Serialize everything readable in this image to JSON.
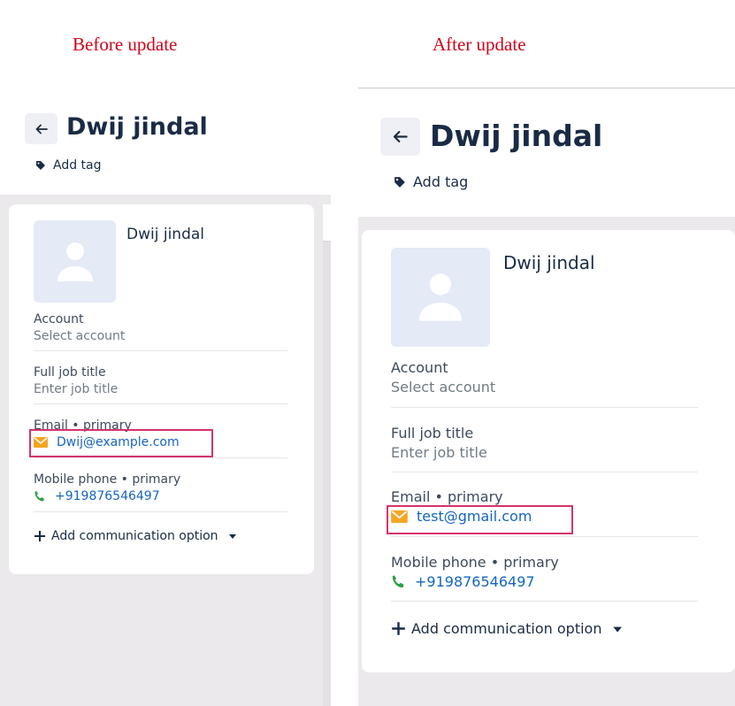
{
  "captions": {
    "before": "Before update",
    "after": "After update"
  },
  "before": {
    "title": "Dwij jindal",
    "add_tag": "Add tag",
    "card_name": "Dwij jindal",
    "account_label": "Account",
    "account_value": "Select account",
    "job_label": "Full job title",
    "job_value": "Enter job title",
    "email_label": "Email • primary",
    "email_value": "Dwij@example.com",
    "phone_label": "Mobile phone • primary",
    "phone_value": "+919876546497",
    "add_comm": "Add communication option"
  },
  "after": {
    "title": "Dwij jindal",
    "add_tag": "Add tag",
    "card_name": "Dwij jindal",
    "account_label": "Account",
    "account_value": "Select account",
    "job_label": "Full job title",
    "job_value": "Enter job title",
    "email_label": "Email • primary",
    "email_value": "test@gmail.com",
    "phone_label": "Mobile phone • primary",
    "phone_value": "+919876546497",
    "add_comm": "Add communication option"
  },
  "colors": {
    "caption": "#d0021b",
    "highlight": "#d6336c",
    "link": "#1565c0",
    "email_icon": "#f5a623",
    "phone_icon": "#2e9e44"
  },
  "icons": [
    "back-arrow-icon",
    "tag-icon",
    "person-icon",
    "email-icon",
    "phone-icon",
    "plus-icon",
    "caret-down-icon"
  ]
}
